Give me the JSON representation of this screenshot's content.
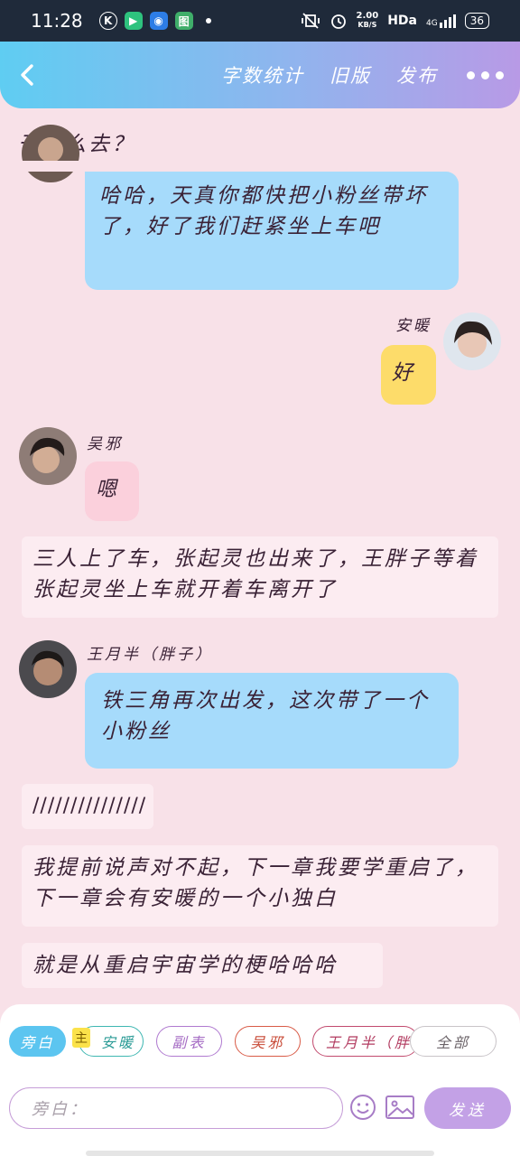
{
  "status_bar": {
    "time": "11:28",
    "app_icons": [
      "K",
      "▶",
      "◉",
      "图"
    ],
    "speed_value": "2.00",
    "speed_unit": "KB/S",
    "hd": "HDa",
    "network": "4G",
    "battery": "36"
  },
  "header": {
    "links": [
      "字数统计",
      "旧版",
      "发布"
    ]
  },
  "chat": {
    "prev_line": "干什么去？",
    "messages": [
      {
        "speaker": "",
        "text": "哈哈，天真你都快把小粉丝带坏了，好了我们赶紧坐上车吧"
      },
      {
        "speaker": "安暖",
        "text": "好"
      },
      {
        "speaker": "吴邪",
        "text": "嗯"
      },
      {
        "speaker": "",
        "text": "三人上了车，张起灵也出来了，王胖子等着张起灵坐上车就开着车离开了"
      },
      {
        "speaker": "王月半（胖子）",
        "text": "铁三角再次出发，这次带了一个小粉丝"
      },
      {
        "speaker": "",
        "text": "///////////////"
      },
      {
        "speaker": "",
        "text": "我提前说声对不起，下一章我要学重启了，下一章会有安暖的一个小独白"
      },
      {
        "speaker": "",
        "text": "就是从重启宇宙学的梗哈哈哈"
      }
    ]
  },
  "role_chips": [
    "旁白",
    "安暖",
    "副表",
    "吴邪",
    "王月半（胖子）",
    "全部"
  ],
  "chip_marker": "主",
  "input": {
    "placeholder": "旁白："
  },
  "send_label": "发送",
  "colors": {
    "background": "#f8e1e8",
    "bubble_blue": "#a6dbfb",
    "bubble_yellow": "#fddc6a",
    "bubble_pink": "#fbd0dc",
    "send": "#c3a1e6"
  }
}
